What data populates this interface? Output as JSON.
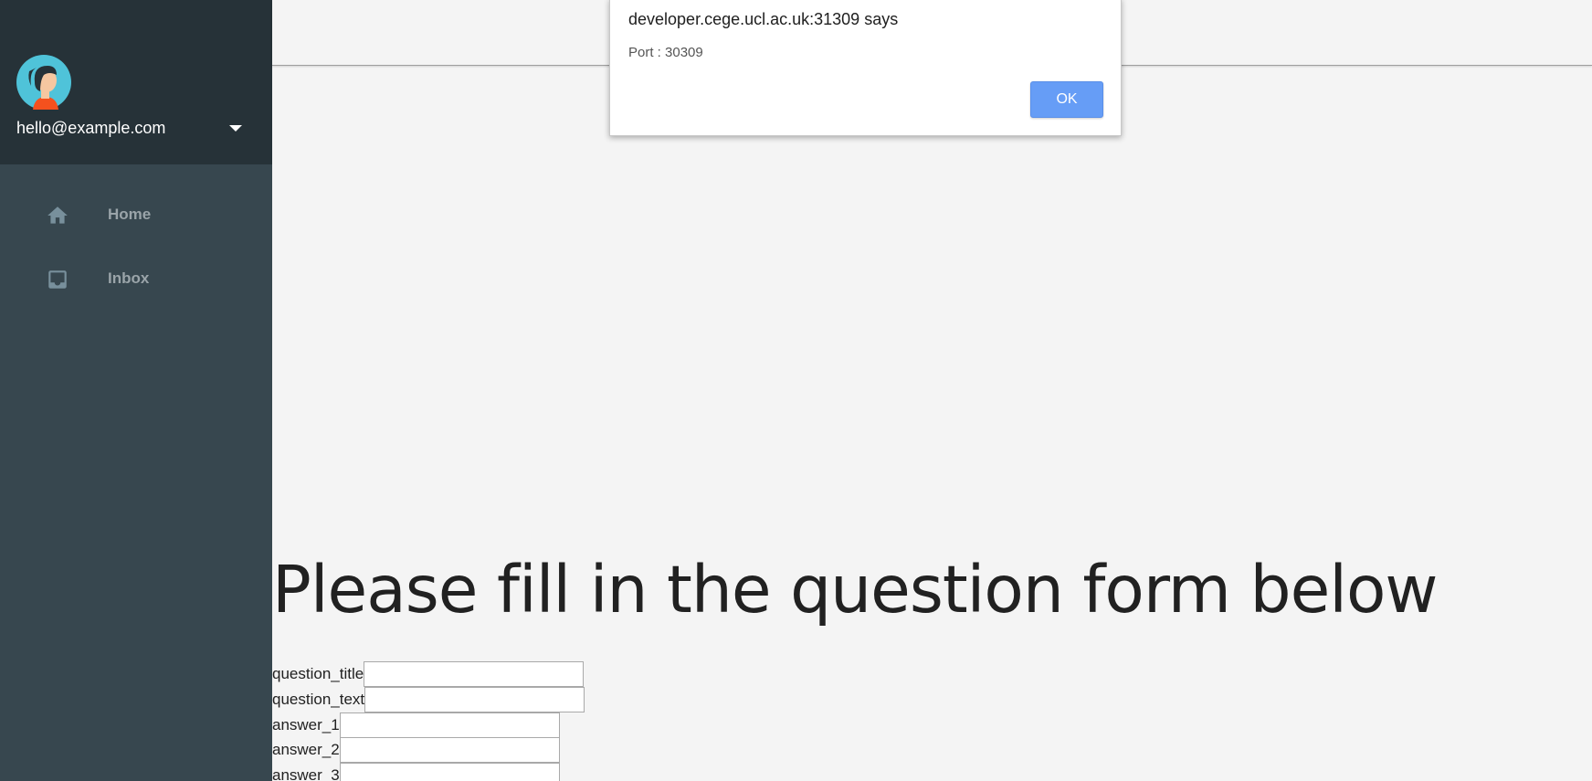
{
  "sidebar": {
    "user_email": "hello@example.com",
    "items": [
      {
        "label": "Home",
        "icon": "home-icon"
      },
      {
        "label": "Inbox",
        "icon": "inbox-icon"
      }
    ]
  },
  "main": {
    "heading": "Please fill in the question form below",
    "form": {
      "fields": [
        {
          "label": "question_title",
          "value": ""
        },
        {
          "label": "question_text",
          "value": ""
        },
        {
          "label": "answer_1",
          "value": ""
        },
        {
          "label": "answer_2",
          "value": ""
        },
        {
          "label": "answer_3",
          "value": ""
        }
      ]
    }
  },
  "dialog": {
    "title": "developer.cege.ucl.ac.uk:31309 says",
    "message": "Port : 30309",
    "ok_label": "OK"
  },
  "colors": {
    "sidebar_bg": "#37474f",
    "sidebar_header_bg": "#263238",
    "ok_button": "#669df6",
    "page_bg": "#f4f4f4"
  }
}
